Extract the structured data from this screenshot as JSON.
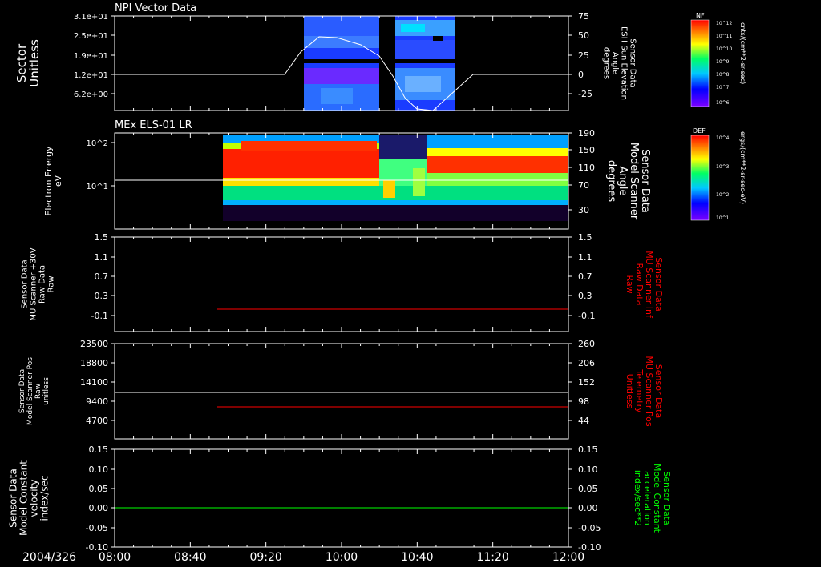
{
  "colors": {
    "background": "#000000",
    "axis": "#ffffff",
    "red_trace": "#ff0000",
    "green_trace": "#00ff00",
    "white_trace": "#ffffff"
  },
  "date_label": "2004/326",
  "time_ticks": [
    "08:00",
    "08:40",
    "09:20",
    "10:00",
    "10:40",
    "11:20",
    "12:00"
  ],
  "chart_data": [
    {
      "type": "heatmap",
      "title": "NPI Vector Data",
      "ylabel_left": [
        "Sector",
        "Unitless"
      ],
      "yticks_left": [
        "3.1e+01",
        "2.5e+01",
        "1.9e+01",
        "1.2e+01",
        "6.2e+00"
      ],
      "ylabel_right": [
        "Sensor Data",
        "ESH Sun Elevation",
        "Angle",
        "degrees"
      ],
      "yticks_right": [
        "75",
        "50",
        "25",
        "0",
        "-25"
      ],
      "ylim_right": [
        -50,
        75
      ],
      "line_overlay": {
        "name": "ESH Sun Elevation Angle",
        "x": [
          "08:00",
          "09:00",
          "09:40",
          "10:00",
          "10:20",
          "10:40",
          "10:55",
          "11:10",
          "12:00"
        ],
        "y": [
          0,
          0,
          48,
          45,
          30,
          -30,
          -40,
          0,
          0
        ]
      },
      "colorbar": {
        "label": "NF",
        "units": "cnts/(cm**2-sr-sec)",
        "ticks": [
          "10^12",
          "10^11",
          "10^10",
          "10^9",
          "10^8",
          "10^7",
          "10^6"
        ]
      }
    },
    {
      "type": "heatmap",
      "title": "MEx ELS-01 LR",
      "ylabel_left": [
        "Electron Energy",
        "eV"
      ],
      "yticks_left": [
        "10^2",
        "10^1"
      ],
      "ylabel_right": [
        "Sensor Data",
        "Model Scanner",
        "Angle",
        "degrees"
      ],
      "yticks_right": [
        "190",
        "150",
        "110",
        "70",
        "30"
      ],
      "line_overlay": {
        "name": "Model Scanner Angle",
        "x": [
          "08:00",
          "12:00"
        ],
        "y": [
          90,
          90
        ]
      },
      "colorbar": {
        "label": "DEF",
        "units": "ergs/(cm**2-sr-sec-eV)",
        "ticks": [
          "10^4",
          "10^3",
          "10^2",
          "10^1"
        ]
      }
    },
    {
      "type": "line",
      "ylabel_left": [
        "Sensor Data",
        "MU Scanner +30V",
        "Raw Data",
        "Raw"
      ],
      "yticks_left": [
        "1.5",
        "1.1",
        "0.7",
        "0.3",
        "-0.1"
      ],
      "ylim": [
        -0.3,
        1.5
      ],
      "ylabel_right": [
        "Sensor Data",
        "MU Scanner Inf",
        "Raw Data",
        "Raw"
      ],
      "yticks_right": [
        "1.5",
        "1.1",
        "0.7",
        "0.3",
        "-0.1"
      ],
      "series": [
        {
          "name": "MU Scanner Inf",
          "x": [
            "08:53",
            "12:00"
          ],
          "y": [
            -0.05,
            -0.05
          ]
        }
      ]
    },
    {
      "type": "line",
      "ylabel_left": [
        "Sensor Data",
        "Model Scanner Pos",
        "Raw",
        "unitless"
      ],
      "yticks_left": [
        "23500",
        "18800",
        "14100",
        "9400",
        "4700"
      ],
      "ylim": [
        0,
        23500
      ],
      "ylabel_right": [
        "Sensor Data",
        "MU Scanner Pos",
        "Telemetry",
        "Unitless"
      ],
      "yticks_right": [
        "260",
        "206",
        "152",
        "98",
        "44"
      ],
      "series": [
        {
          "name": "Model Scanner Pos",
          "x": [
            "08:00",
            "12:00"
          ],
          "y": [
            11800,
            11800
          ]
        },
        {
          "name": "MU Scanner Pos",
          "x": [
            "08:53",
            "12:00"
          ],
          "y": [
            9000,
            9000
          ]
        }
      ]
    },
    {
      "type": "line",
      "ylabel_left": [
        "Sensor Data",
        "Model Constant",
        "velocity",
        "index/sec"
      ],
      "yticks_left": [
        "0.15",
        "0.10",
        "0.05",
        "0.00",
        "-0.05",
        "-0.10"
      ],
      "ylim": [
        -0.1,
        0.15
      ],
      "ylabel_right": [
        "Sensor Data",
        "Model Constant",
        "acceleration",
        "index/sec**2"
      ],
      "yticks_right": [
        "0.15",
        "0.10",
        "0.05",
        "0.00",
        "-0.05",
        "-0.10"
      ],
      "series": [
        {
          "name": "Model Constant acceleration",
          "x": [
            "08:00",
            "12:00"
          ],
          "y": [
            0.0,
            0.0
          ]
        }
      ]
    }
  ]
}
